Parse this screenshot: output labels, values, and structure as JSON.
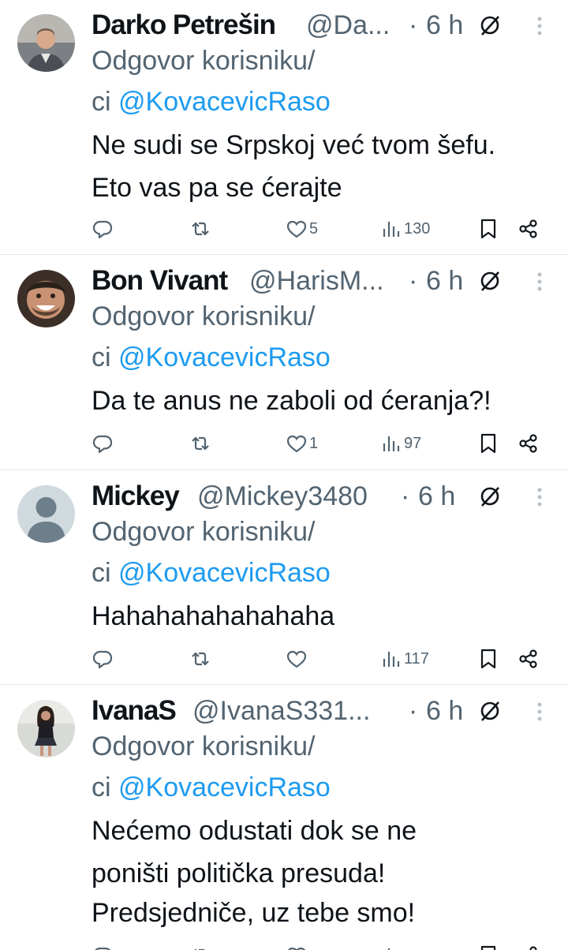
{
  "reply_prefix": "Odgovor korisniku/",
  "reply_prefix_2": "ci ",
  "time_sep": "·",
  "colors": {
    "text": "#0f1419",
    "muted": "#536471",
    "link": "#1d9bf0",
    "divider": "#e3e6e9"
  },
  "tweets": [
    {
      "name": "Darko Petrešin",
      "handle": "@Da...",
      "time": "6 h",
      "mention": "@KovacevicRaso",
      "lines": [
        "Ne sudi se Srpskoj već tvom šefu.",
        "Eto vas pa se ćerajte"
      ],
      "likes": "5",
      "views": "130",
      "avatar": "man-in-vest-avatar"
    },
    {
      "name": "Bon Vivant",
      "handle": "@HarisM...",
      "time": "6 h",
      "mention": "@KovacevicRaso",
      "lines": [
        "Da te anus ne zaboli od ćeranja?!"
      ],
      "likes": "1",
      "views": "97",
      "avatar": "smiling-man-avatar"
    },
    {
      "name": "Mickey",
      "handle": "@Mickey3480",
      "time": "6 h",
      "mention": "@KovacevicRaso",
      "lines": [
        "Hahahahahahahaha"
      ],
      "likes": "",
      "views": "117",
      "avatar": "default-avatar"
    },
    {
      "name": "IvanaS",
      "handle": "@IvanaS331...",
      "time": "6 h",
      "mention": "@KovacevicRaso",
      "lines": [
        "Nećemo odustati dok se ne",
        "poništi politička presuda!",
        "Predsjedniče, uz tebe smo!"
      ],
      "likes": "",
      "views": "",
      "avatar": "woman-photo-avatar"
    }
  ]
}
